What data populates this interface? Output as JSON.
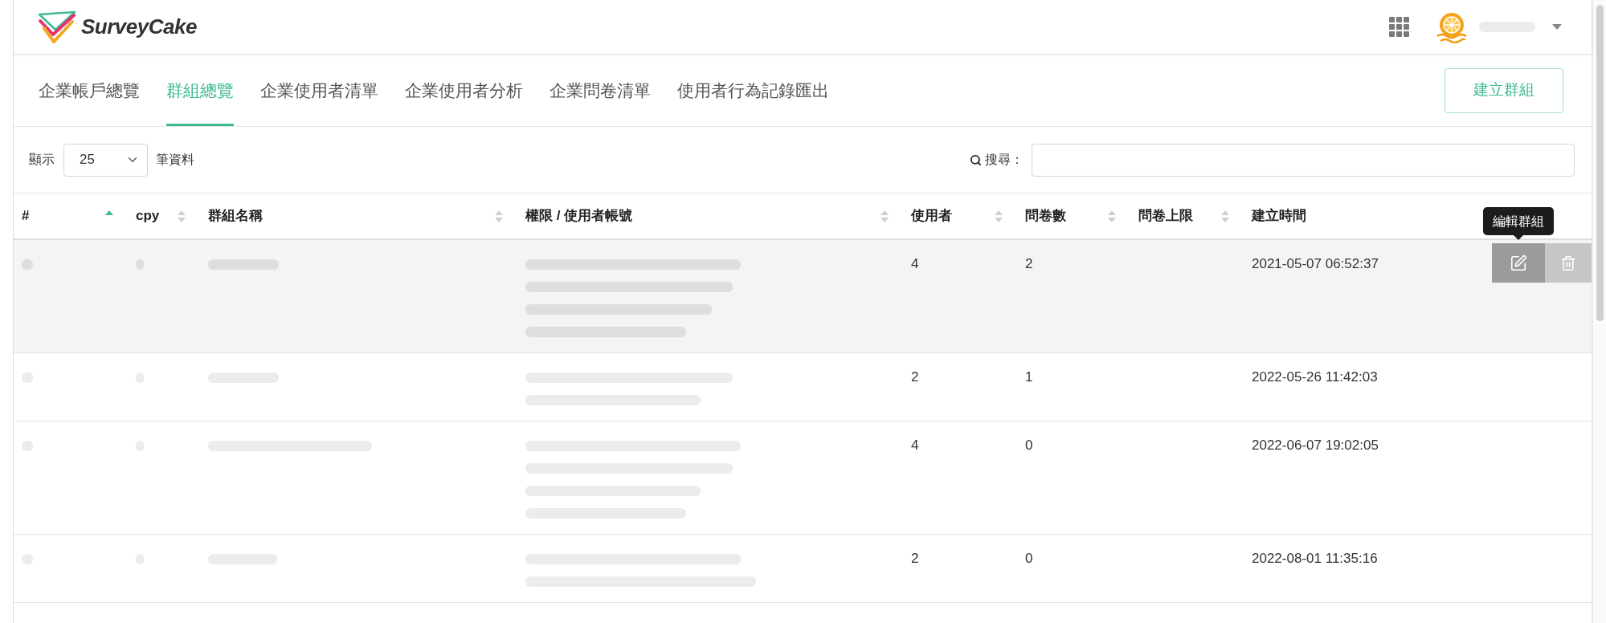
{
  "header": {
    "logo": "SurveyCake",
    "user": {
      "name": {
        "kind": "redacted"
      }
    }
  },
  "tabs": [
    {
      "label": "企業帳戶總覽",
      "selected": false
    },
    {
      "label": "群組總覽",
      "selected": true
    },
    {
      "label": "企業使用者清單",
      "selected": false
    },
    {
      "label": "企業使用者分析",
      "selected": false
    },
    {
      "label": "企業問卷清單",
      "selected": false
    },
    {
      "label": "使用者行為記錄匯出",
      "selected": false
    }
  ],
  "create_button": "建立群組",
  "length_control": {
    "prefix": "顯示",
    "value": "25",
    "suffix": "筆資料"
  },
  "search": {
    "label": "搜尋："
  },
  "table": {
    "columns": [
      {
        "label": "#",
        "sortable": true,
        "sorted": true
      },
      {
        "label": "cpy",
        "sortable": true,
        "sorted": false
      },
      {
        "label": "群組名稱",
        "sortable": true,
        "sorted": false
      },
      {
        "label": "權限 / 使用者帳號",
        "sortable": true,
        "sorted": false
      },
      {
        "label": "使用者",
        "sortable": true,
        "sorted": false
      },
      {
        "label": "問卷數",
        "sortable": true,
        "sorted": false
      },
      {
        "label": "問卷上限",
        "sortable": true,
        "sorted": false
      },
      {
        "label": "建立時間",
        "sortable": false
      }
    ],
    "rows": [
      {
        "hovered": true,
        "id": {
          "kind": "redacted"
        },
        "cpy": {
          "kind": "redacted"
        },
        "name": {
          "kind": "redacted"
        },
        "accounts": [
          {
            "kind": "redacted"
          },
          {
            "kind": "redacted"
          },
          {
            "kind": "redacted"
          },
          {
            "kind": "redacted"
          }
        ],
        "users": "4",
        "surveys": "2",
        "created": "2021-05-07 06:52:37",
        "tooltip": "編輯群組"
      },
      {
        "hovered": false,
        "id": {
          "kind": "redacted"
        },
        "cpy": {
          "kind": "redacted"
        },
        "name": {
          "kind": "redacted"
        },
        "accounts": [
          {
            "kind": "redacted"
          },
          {
            "kind": "redacted"
          }
        ],
        "users": "2",
        "surveys": "1",
        "created": "2022-05-26 11:42:03"
      },
      {
        "hovered": false,
        "id": {
          "kind": "redacted"
        },
        "cpy": {
          "kind": "redacted"
        },
        "name": {
          "kind": "redacted"
        },
        "accounts": [
          {
            "kind": "redacted"
          },
          {
            "kind": "redacted"
          },
          {
            "kind": "redacted"
          },
          {
            "kind": "redacted"
          }
        ],
        "users": "4",
        "surveys": "0",
        "created": "2022-06-07 19:02:05"
      },
      {
        "hovered": false,
        "id": {
          "kind": "redacted"
        },
        "cpy": {
          "kind": "redacted"
        },
        "name": {
          "kind": "redacted"
        },
        "accounts": [
          {
            "kind": "redacted"
          },
          {
            "kind": "redacted"
          }
        ],
        "users": "2",
        "surveys": "0",
        "created": "2022-08-01 11:35:16"
      }
    ]
  }
}
